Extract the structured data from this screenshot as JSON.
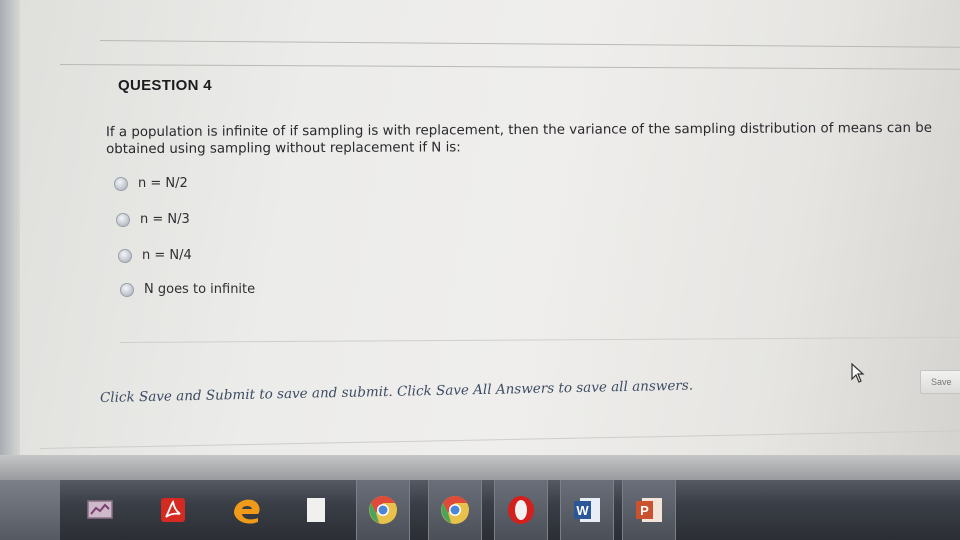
{
  "question": {
    "title": "QUESTION 4",
    "text": "If a population is infinite of if sampling is with replacement, then the variance of the sampling distribution of means can be obtained using sampling without replacement if N is:"
  },
  "options": [
    {
      "label": "n = N/2"
    },
    {
      "label": "n = N/3"
    },
    {
      "label": "n = N/4"
    },
    {
      "label": "N goes to infinite"
    }
  ],
  "footer": {
    "instructions": "Click Save and Submit to save and submit. Click Save All Answers to save all answers."
  },
  "buttons": {
    "save_label": "Save"
  },
  "taskbar": {
    "apps": [
      {
        "icon": "monitor-icon"
      },
      {
        "icon": "adobe-reader-icon",
        "color": "#d42a22"
      },
      {
        "icon": "edge-browser-icon",
        "color": "#2a8fd6"
      },
      {
        "icon": "file-icon"
      },
      {
        "icon": "chrome-icon"
      },
      {
        "icon": "chrome-icon"
      },
      {
        "icon": "opera-icon",
        "color": "#d4201c"
      },
      {
        "icon": "word-icon",
        "color": "#2b5797"
      },
      {
        "icon": "powerpoint-icon",
        "color": "#c8532e"
      }
    ]
  }
}
